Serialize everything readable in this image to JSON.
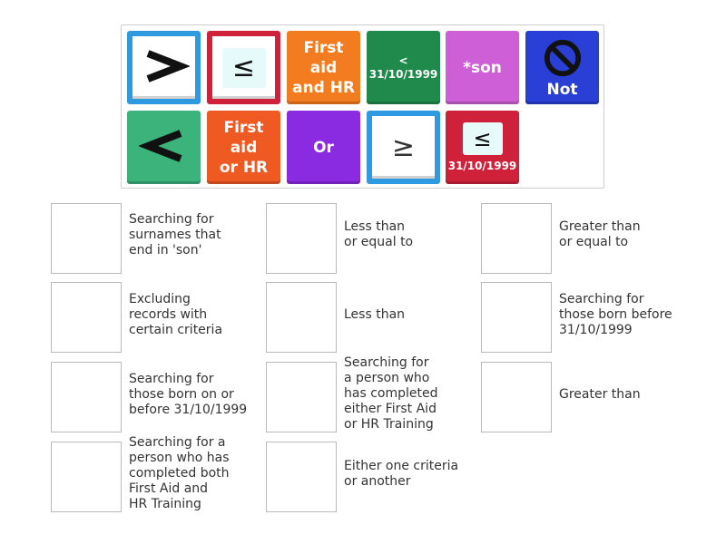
{
  "tiles": [
    {
      "id": "gt",
      "text": ">",
      "icon": "greater-than-icon",
      "bg": "#ffffff",
      "border": "#2f9ae0"
    },
    {
      "id": "le",
      "text": "≤",
      "icon": "less-equal-icon",
      "bg": "#ffffff",
      "border": "#d0213b"
    },
    {
      "id": "first_aid_and_hr",
      "text": "First\naid\nand HR",
      "bg": "#f47c20"
    },
    {
      "id": "lt_date",
      "text": "<\n31/10/1999",
      "bg": "#1f8a4c"
    },
    {
      "id": "son",
      "text": "*son",
      "bg": "#cf5fd6"
    },
    {
      "id": "not",
      "text": "Not",
      "icon": "no-symbol-icon",
      "bg": "#2a3fd6"
    },
    {
      "id": "lt",
      "text": "<",
      "icon": "less-than-icon",
      "bg": "#3bb37a"
    },
    {
      "id": "first_aid_or_hr",
      "text": "First\naid\nor HR",
      "bg": "#ef5a23"
    },
    {
      "id": "or",
      "text": "Or",
      "bg": "#8a2be2"
    },
    {
      "id": "ge",
      "text": "≥",
      "icon": "greater-equal-icon",
      "bg": "#ffffff",
      "border": "#2f9ae0"
    },
    {
      "id": "le_date",
      "symbol": "≤",
      "text": "31/10/1999",
      "bg": "#d0213b"
    }
  ],
  "targets": [
    {
      "label": "Searching for\nsurnames that\nend in 'son'"
    },
    {
      "label": "Less than\nor equal to"
    },
    {
      "label": "Greater than\nor equal to"
    },
    {
      "label": "Excluding\nrecords with\ncertain criteria"
    },
    {
      "label": "Less than"
    },
    {
      "label": "Searching for\nthose born before\n31/10/1999"
    },
    {
      "label": "Searching for\nthose born on or\nbefore 31/10/1999"
    },
    {
      "label": "Searching for\na person who\nhas completed\neither First Aid\nor HR Training"
    },
    {
      "label": "Greater than"
    },
    {
      "label": "Searching for a\nperson who has\ncompleted both\nFirst Aid and\nHR Training"
    },
    {
      "label": "Either one criteria\nor another"
    }
  ]
}
